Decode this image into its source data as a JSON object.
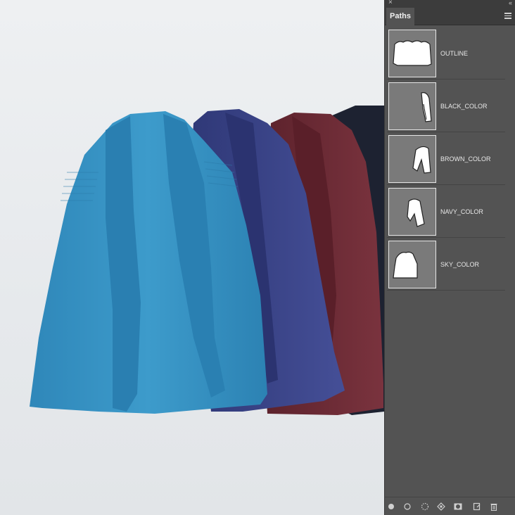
{
  "panel": {
    "close_glyph": "×",
    "collapse_glyph": "‹‹",
    "tab_label": "Paths",
    "menu_icon": "panel-menu-icon",
    "paths": [
      {
        "label": "OUTLINE",
        "thumb_icon": "outline-path-thumbnail"
      },
      {
        "label": "BLACK_COLOR",
        "thumb_icon": "black-color-path-thumbnail"
      },
      {
        "label": "BROWN_COLOR",
        "thumb_icon": "brown-color-path-thumbnail"
      },
      {
        "label": "NAVY_COLOR",
        "thumb_icon": "navy-color-path-thumbnail"
      },
      {
        "label": "SKY_COLOR",
        "thumb_icon": "sky-color-path-thumbnail"
      }
    ],
    "bottom_tools": [
      "fill-path-icon",
      "stroke-path-icon",
      "load-as-selection-icon",
      "make-work-path-icon",
      "add-mask-icon",
      "new-path-icon",
      "delete-path-icon"
    ]
  },
  "canvas": {
    "colors": {
      "sky": "#3a93c3",
      "navy": "#3a4488",
      "brown": "#6a2a34",
      "black": "#1f2433"
    }
  }
}
